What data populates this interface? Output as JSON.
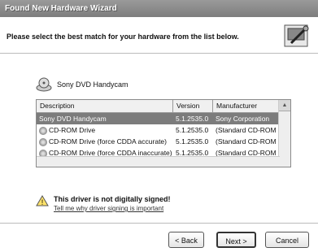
{
  "window": {
    "title": "Found New Hardware Wizard"
  },
  "header": {
    "instruction": "Please select the best match for your hardware from the list below."
  },
  "device": {
    "name": "Sony DVD Handycam"
  },
  "list": {
    "columns": [
      "Description",
      "Version",
      "Manufacturer"
    ],
    "rows": [
      {
        "description": "Sony DVD Handycam",
        "version": "5.1.2535.0",
        "manufacturer": "Sony Corporation",
        "selected": true
      },
      {
        "description": "CD-ROM Drive",
        "version": "5.1.2535.0",
        "manufacturer": "(Standard CD-ROM dr"
      },
      {
        "description": "CD-ROM Drive (force CDDA accurate)",
        "version": "5.1.2535.0",
        "manufacturer": "(Standard CD-ROM dr"
      },
      {
        "description": "CD-ROM Drive (force CDDA inaccurate)",
        "version": "5.1.2535.0",
        "manufacturer": "(Standard CD-ROM dr"
      }
    ]
  },
  "warning": {
    "title": "This driver is not digitally signed!",
    "link": "Tell me why driver signing is important"
  },
  "buttons": {
    "back": "< Back",
    "next": "Next >",
    "cancel": "Cancel"
  }
}
